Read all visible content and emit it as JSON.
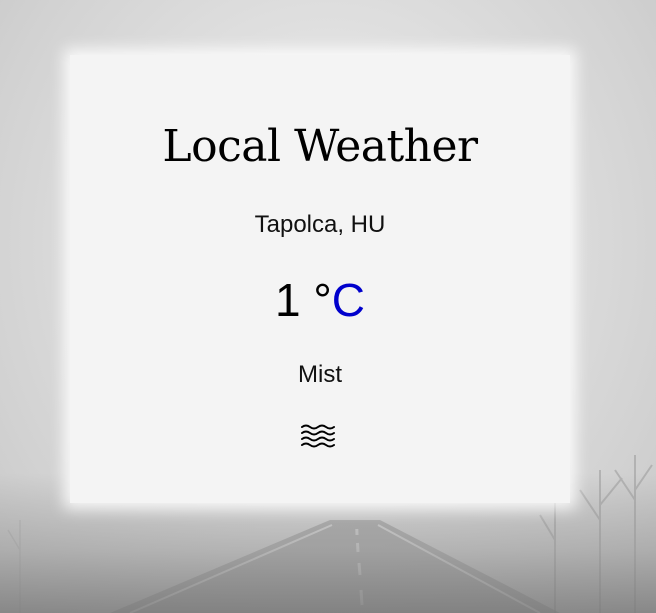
{
  "header": {
    "title": "Local Weather"
  },
  "weather": {
    "location": "Tapolca, HU",
    "temperature": "1",
    "degree_symbol": "°",
    "unit": "C",
    "description": "Mist",
    "icon": "mist-icon"
  },
  "colors": {
    "card_background": "#f4f4f4",
    "unit_link": "#0000cc",
    "text": "#000000"
  }
}
